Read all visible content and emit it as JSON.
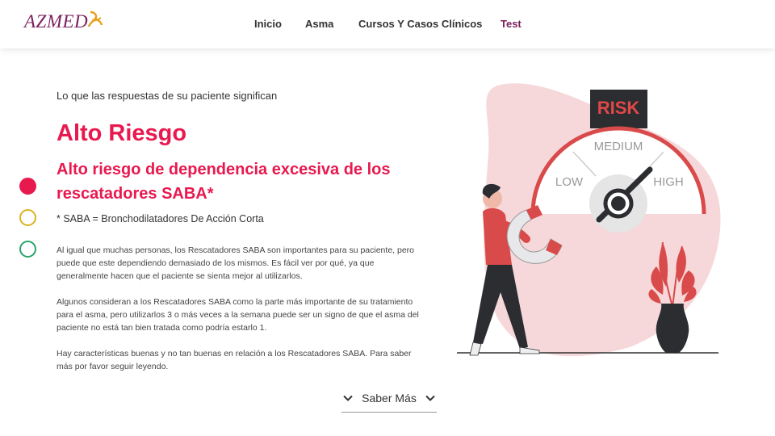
{
  "header": {
    "logo_text": "AZMED",
    "nav": [
      "Inicio",
      "Asma",
      "Cursos Y Casos Clínicos",
      "Test"
    ]
  },
  "main": {
    "kicker": "Lo que las respuestas de su paciente significan",
    "title": "Alto Riesgo",
    "subtitle": "Alto riesgo de dependencia excesiva de los rescatadores SABA*",
    "note": "* SABA = Bronchodilatadores De Acción Corta",
    "paragraphs": [
      "Al igual que muchas personas, los Rescatadores SABA son importantes para su paciente, pero puede que este dependiendo demasiado de los mismos. Es fácil ver por qué, ya que generalmente hacen que el paciente se sienta mejor al utilizarlos.",
      "Algunos consideran a los Rescatadores SABA como la parte más importante de su tratamiento para el asma, pero utilizarlos 3 o más veces a la semana puede ser un signo de que el asma del paciente no está tan bien tratada como podría estarlo 1.",
      "Hay características buenas y no tan buenas en relación a los Rescatadores SABA. Para saber más por favor seguir leyendo."
    ],
    "more_label": "Saber Más"
  },
  "illustration": {
    "sign_text": "RISK",
    "gauge_labels": {
      "low": "LOW",
      "medium": "MEDIUM",
      "high": "HIGH"
    }
  },
  "colors": {
    "accent": "#e8194f",
    "brand": "#7a1f5c",
    "dot_high": "#e8194f",
    "dot_medium": "#d9b420",
    "dot_low": "#2aa36b"
  }
}
